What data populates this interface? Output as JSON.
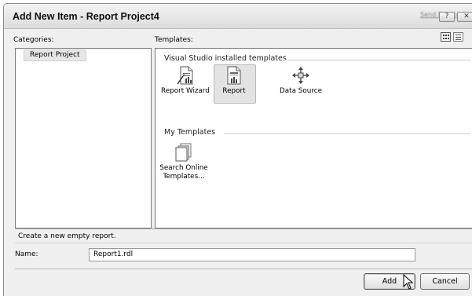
{
  "window": {
    "title": "Add New Item - Report Project4",
    "send_feedback": "Send Feedback",
    "help_button": "?",
    "close_button": "✕"
  },
  "categories": {
    "label": "Categories:",
    "items": [
      "Report Project"
    ]
  },
  "templates": {
    "label": "Templates:",
    "groups": [
      {
        "heading": "Visual Studio installed templates",
        "items": [
          {
            "label": "Report Wizard",
            "icon": "report-wizard-icon"
          },
          {
            "label": "Report",
            "icon": "report-icon",
            "selected": true
          },
          {
            "label": "Data Source",
            "icon": "data-source-icon"
          }
        ]
      },
      {
        "heading": "My Templates",
        "items": [
          {
            "label_line1": "Search Online",
            "label_line2": "Templates...",
            "icon": "search-online-templates-icon"
          }
        ]
      }
    ]
  },
  "status": {
    "description": "Create a new empty report."
  },
  "name_field": {
    "label": "Name:",
    "value": "Report1.rdl"
  },
  "buttons": {
    "add": "Add",
    "cancel": "Cancel"
  }
}
